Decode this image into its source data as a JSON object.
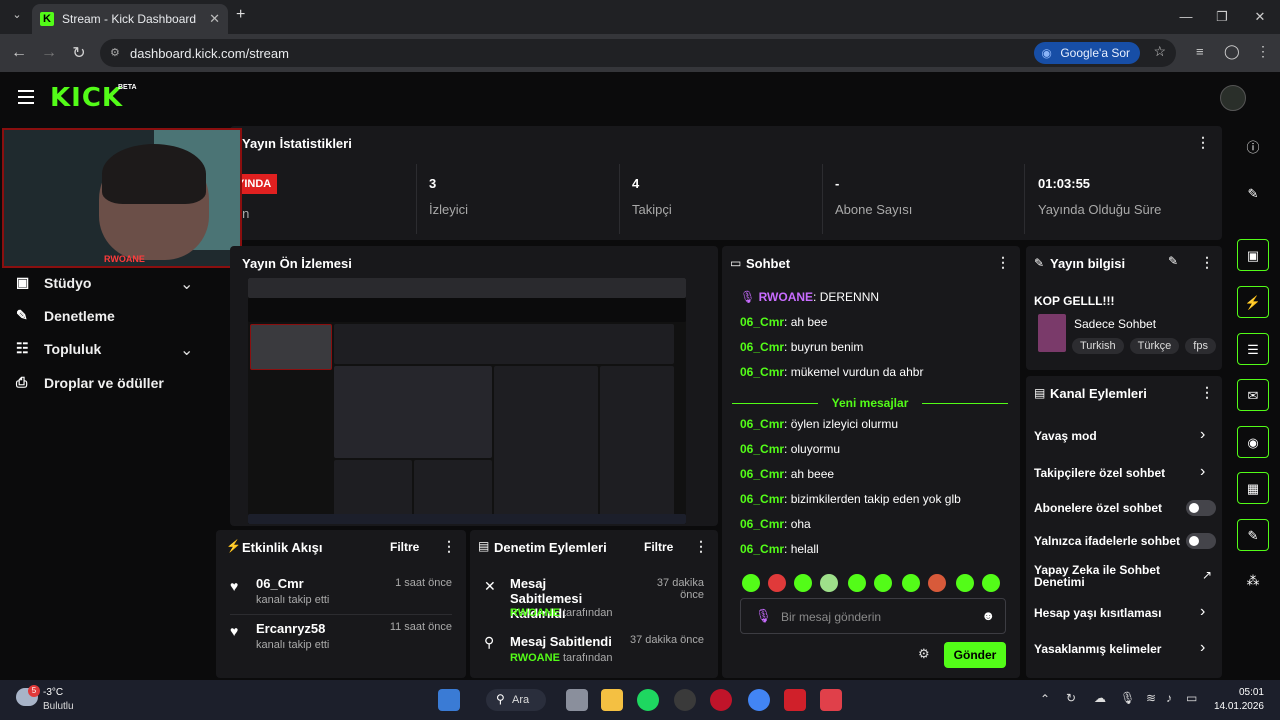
{
  "browser": {
    "tab_title": "Stream - Kick Dashboard",
    "url": "dashboard.kick.com/stream",
    "google_btn": "Google'a Sor"
  },
  "header": {
    "logo": "KICK",
    "beta": "BETA"
  },
  "webcam": {
    "name_tag": "RWOANE"
  },
  "sidebar": {
    "items": [
      {
        "label": "Stüdyo",
        "icon": "studio-icon",
        "chevron": true
      },
      {
        "label": "Denetleme",
        "icon": "wrench-icon",
        "chevron": false
      },
      {
        "label": "Topluluk",
        "icon": "community-icon",
        "chevron": true
      },
      {
        "label": "Droplar ve ödüller",
        "icon": "gift-icon",
        "chevron": false
      }
    ]
  },
  "stats": {
    "title": "Yayın İstatistikleri",
    "live_badge": "YINDA",
    "live_label": "yın",
    "items": [
      {
        "value": "3",
        "label": "İzleyici"
      },
      {
        "value": "4",
        "label": "Takipçi"
      },
      {
        "value": "-",
        "label": "Abone Sayısı"
      },
      {
        "value": "01:03:55",
        "label": "Yayında Olduğu Süre"
      }
    ]
  },
  "preview": {
    "title": "Yayın Ön İzlemesi"
  },
  "chat": {
    "title": "Sohbet",
    "messages_top": [
      {
        "user": "RWOANE",
        "text": "DERENNN",
        "color": "purple"
      },
      {
        "user": "06_Cmr",
        "text": "ah bee"
      },
      {
        "user": "06_Cmr",
        "text": "buyrun benim"
      },
      {
        "user": "06_Cmr",
        "text": "mükemel vurdun da ahbr"
      }
    ],
    "new_messages": "Yeni mesajlar",
    "messages_bottom": [
      {
        "user": "06_Cmr",
        "text": "öylen izleyici olurmu"
      },
      {
        "user": "06_Cmr",
        "text": "oluyormu"
      },
      {
        "user": "06_Cmr",
        "text": "ah beee"
      },
      {
        "user": "06_Cmr",
        "text": "bizimkilerden takip eden yok glb"
      },
      {
        "user": "06_Cmr",
        "text": "oha"
      },
      {
        "user": "06_Cmr",
        "text": "helall"
      }
    ],
    "input_placeholder": "Bir mesaj gönderin",
    "send": "Gönder"
  },
  "stream_info": {
    "title": "Yayın bilgisi",
    "stream_title": "KOP GELLL!!!",
    "category": "Sadece Sohbet",
    "tags": [
      "Turkish",
      "Türkçe",
      "fps"
    ]
  },
  "channel_actions": {
    "title": "Kanal Eylemleri",
    "items": [
      {
        "label": "Yavaş mod",
        "type": "arrow"
      },
      {
        "label": "Takipçilere özel sohbet",
        "type": "arrow"
      },
      {
        "label": "Abonelere özel sohbet",
        "type": "toggle"
      },
      {
        "label": "Yalnızca ifadelerle sohbet",
        "type": "toggle"
      },
      {
        "label": "Yapay Zeka ile Sohbet Denetimi",
        "type": "external"
      },
      {
        "label": "Hesap yaşı kısıtlaması",
        "type": "arrow"
      },
      {
        "label": "Yasaklanmış kelimeler",
        "type": "arrow"
      }
    ]
  },
  "activity": {
    "title": "Etkinlik Akışı",
    "filter": "Filtre",
    "items": [
      {
        "name": "06_Cmr",
        "sub": "kanalı takip etti",
        "time": "1 saat önce"
      },
      {
        "name": "Ercanryz58",
        "sub": "kanalı takip etti",
        "time": "11 saat önce"
      }
    ]
  },
  "moderation": {
    "title": "Denetim Eylemleri",
    "filter": "Filtre",
    "items": [
      {
        "name": "Mesaj Sabitlemesi Kaldırıldı",
        "by": "RWOANE",
        "suffix": "tarafından",
        "time": "37 dakika önce"
      },
      {
        "name": "Mesaj Sabitlendi",
        "by": "RWOANE",
        "suffix": "tarafından",
        "time": "37 dakika önce"
      }
    ]
  },
  "taskbar": {
    "weather_temp": "-3°C",
    "weather_desc": "Bulutlu",
    "badge": "5",
    "search": "Ara",
    "time": "05:01",
    "date": "14.01.2026"
  },
  "colors": {
    "accent": "#53fc18",
    "live": "#e02020",
    "panel": "#18181b"
  }
}
